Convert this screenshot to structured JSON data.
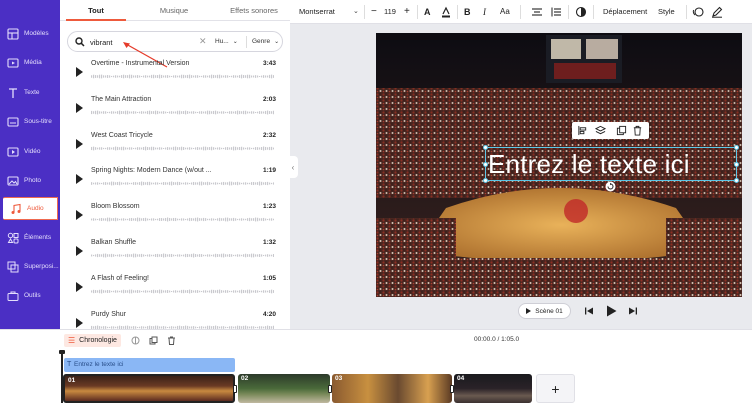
{
  "sidebar": {
    "items": [
      {
        "label": "Modèles",
        "icon": "templates-icon"
      },
      {
        "label": "Média",
        "icon": "media-icon"
      },
      {
        "label": "Texte",
        "icon": "text-icon"
      },
      {
        "label": "Sous-titre",
        "icon": "subtitle-icon"
      },
      {
        "label": "Vidéo",
        "icon": "video-icon"
      },
      {
        "label": "Photo",
        "icon": "photo-icon"
      },
      {
        "label": "Audio",
        "icon": "music-icon"
      },
      {
        "label": "Éléments",
        "icon": "elements-icon"
      },
      {
        "label": "Superposi...",
        "icon": "overlay-icon"
      },
      {
        "label": "Outils",
        "icon": "tools-icon"
      }
    ],
    "active_index": 6
  },
  "audio_panel": {
    "tabs": [
      "Tout",
      "Musique",
      "Effets sonores"
    ],
    "active_tab": "Tout",
    "search": {
      "value": "vibrant",
      "filter_1": "Hu...",
      "filter_2": "Genre"
    },
    "tracks": [
      {
        "title": "Overtime - Instrumental Version",
        "duration": "3:43"
      },
      {
        "title": "The Main Attraction",
        "duration": "2:03"
      },
      {
        "title": "West Coast Tricycle",
        "duration": "2:32"
      },
      {
        "title": "Spring Nights: Modern Dance (w/out ...",
        "duration": "1:19"
      },
      {
        "title": "Bloom Blossom",
        "duration": "1:23"
      },
      {
        "title": "Balkan Shuffle",
        "duration": "1:32"
      },
      {
        "title": "A Flash of Feeling!",
        "duration": "1:05"
      },
      {
        "title": "Purdy Shur",
        "duration": "4:20"
      }
    ]
  },
  "toolbar": {
    "font_family": "Montserrat",
    "font_size": "119",
    "minus": "−",
    "plus": "+",
    "bold": "B",
    "italic": "I",
    "case": "Aa",
    "text_color_glyph": "A",
    "move_label": "Déplacement",
    "style_label": "Style"
  },
  "canvas": {
    "text": "Entrez le texte ici"
  },
  "player": {
    "scene_label": "Scène 01"
  },
  "timeline": {
    "chrono_label": "Chronologie",
    "timecode": "00:00.0 / 1:05.0",
    "text_track_label": "Entrez le texte ici",
    "clips": [
      "01",
      "02",
      "03",
      "04"
    ],
    "add_label": "+"
  },
  "colors": {
    "sidebar_bg": "#4b2fc4",
    "accent": "#ee5a3c",
    "selection": "#5cc8e8",
    "text_track": "#8ab7f5"
  }
}
